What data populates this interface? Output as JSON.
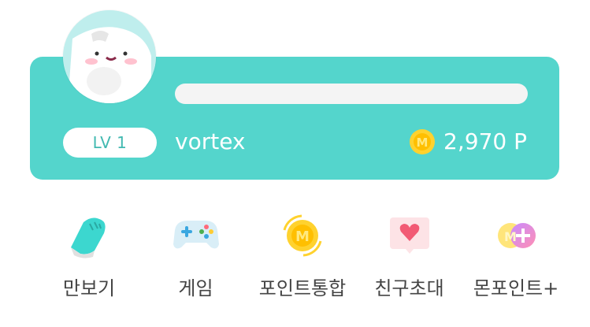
{
  "profile": {
    "level": "LV 1",
    "username": "vortex",
    "points": "2,970 P",
    "progress": 0
  },
  "icons": {
    "avatar": "character-avatar",
    "coin": "m-coin-icon"
  },
  "menu": {
    "items": [
      {
        "label": "만보기",
        "icon": "sneaker-icon"
      },
      {
        "label": "게임",
        "icon": "gamepad-icon"
      },
      {
        "label": "포인트통합",
        "icon": "m-coin-exchange-icon"
      },
      {
        "label": "친구초대",
        "icon": "heart-message-icon"
      },
      {
        "label": "몬포인트+",
        "icon": "m-plus-icon"
      }
    ]
  },
  "colors": {
    "card": "#54d5cc",
    "accent_text": "#42b9b1",
    "coin": "#ffd22e",
    "label": "#444444"
  }
}
